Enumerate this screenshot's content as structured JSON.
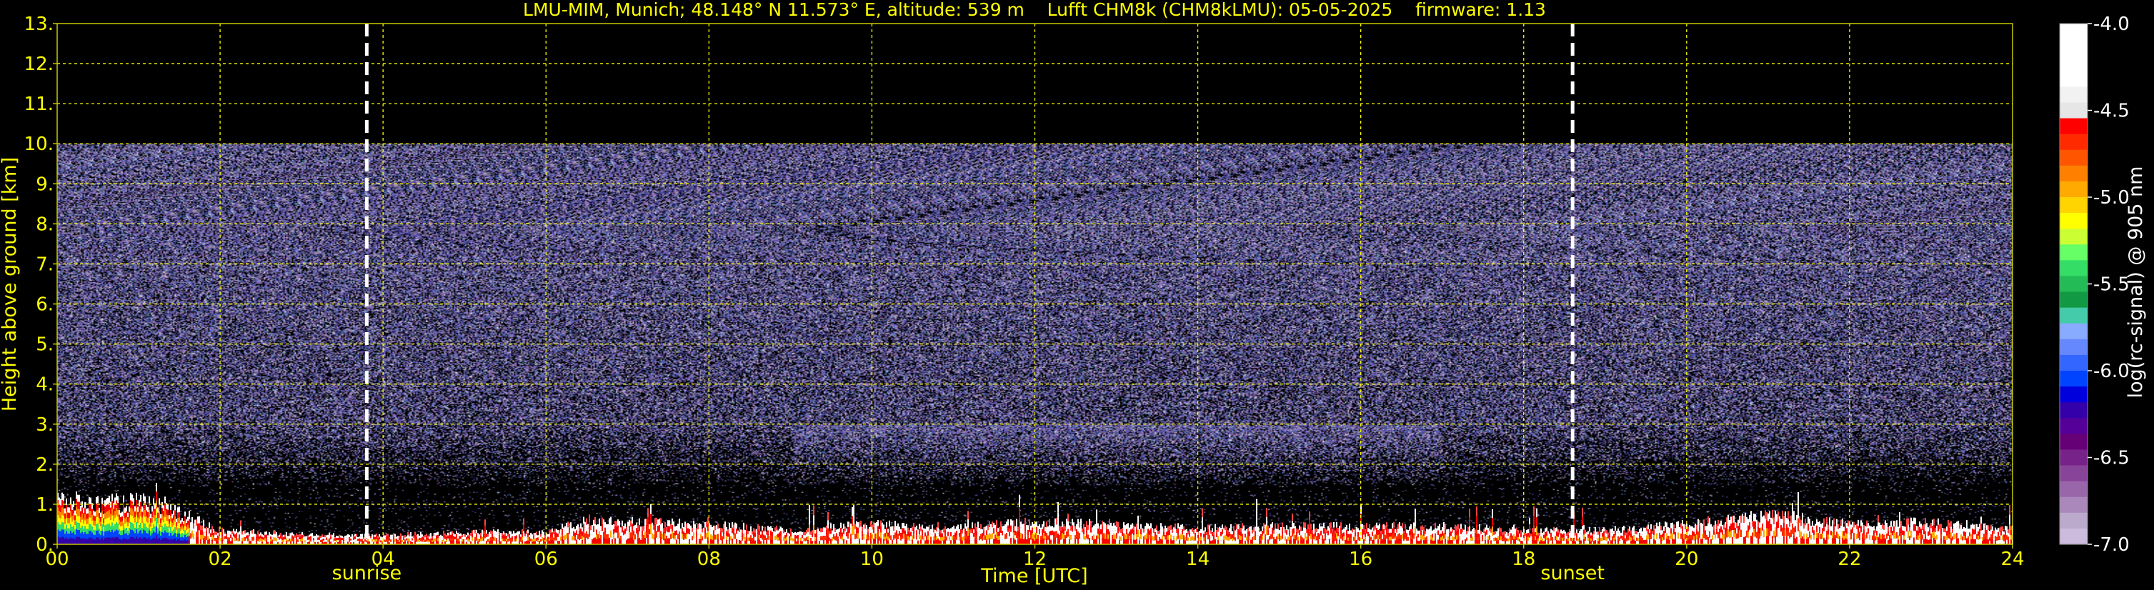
{
  "colors": {
    "background": "#000000",
    "text": "#ffff00",
    "grid": "#ffff00",
    "frame": "#c8c800",
    "marker": "#ffffff",
    "colorbar_text": "#ffffff"
  },
  "chart_data": {
    "type": "heatmap",
    "title": "LMU-MIM, Munich; 48.148° N 11.573° E, altitude: 539 m    Lufft CHM8k (CHM8kLMU): 05-05-2025    firmware: 1.13",
    "xlabel": "Time [UTC]",
    "ylabel": "Height above ground [km]",
    "xlim": [
      0,
      24
    ],
    "ylim": [
      0,
      13
    ],
    "x_ticks": [
      0,
      2,
      4,
      6,
      8,
      10,
      12,
      14,
      16,
      18,
      20,
      22,
      24
    ],
    "x_tick_labels": [
      "00",
      "02",
      "04",
      "06",
      "08",
      "10",
      "12",
      "14",
      "16",
      "18",
      "20",
      "22",
      "24"
    ],
    "y_ticks": [
      0,
      1,
      2,
      3,
      4,
      5,
      6,
      7,
      8,
      9,
      10,
      11,
      12,
      13
    ],
    "y_tick_labels": [
      "0.",
      "1.",
      "2.",
      "3.",
      "4.",
      "5.",
      "6.",
      "7.",
      "8.",
      "9.",
      "10.",
      "11.",
      "12.",
      "13."
    ],
    "grid": true,
    "measurement_top_km": 10.0,
    "events": [
      {
        "label": "sunrise",
        "x": 3.8
      },
      {
        "label": "sunset",
        "x": 18.6
      }
    ],
    "colorbar": {
      "label": "log(rc-signal) @ 905 nm",
      "range": [
        -7.0,
        -4.0
      ],
      "ticks": [
        -4.0,
        -4.5,
        -5.0,
        -5.5,
        -6.0,
        -6.5,
        -7.0
      ],
      "tick_labels": [
        "-4.0",
        "-4.5",
        "-5.0",
        "-5.5",
        "-6.0",
        "-6.5",
        "-7.0"
      ],
      "colors_top_to_bottom": [
        "#ffffff",
        "#ffffff",
        "#ffffff",
        "#ffffff",
        "#f2f2f2",
        "#e6e6e6",
        "#ff0000",
        "#ff2a00",
        "#ff5500",
        "#ff8000",
        "#ffaa00",
        "#ffd400",
        "#ffff00",
        "#ccff33",
        "#66ff66",
        "#33dd66",
        "#22bb55",
        "#119944",
        "#44ccaa",
        "#88aaff",
        "#6688ff",
        "#3366ff",
        "#0044ff",
        "#0000dd",
        "#3300aa",
        "#550099",
        "#660077",
        "#772288",
        "#884499",
        "#9966aa",
        "#aa88bb",
        "#bbaacc",
        "#ccbbdd"
      ]
    },
    "cloud_layer_profile": {
      "note": "approximate height (km) of the dense near-surface signal",
      "x": [
        0,
        0.5,
        1,
        1.5,
        2,
        3,
        4,
        5,
        6,
        6.5,
        7,
        8,
        9,
        10,
        11,
        12,
        13,
        14,
        15,
        16,
        17,
        18,
        19,
        20,
        21,
        22,
        23,
        24
      ],
      "y": [
        1.1,
        1.0,
        1.05,
        0.8,
        0.35,
        0.25,
        0.22,
        0.3,
        0.3,
        0.6,
        0.55,
        0.5,
        0.35,
        0.5,
        0.45,
        0.55,
        0.5,
        0.4,
        0.45,
        0.45,
        0.45,
        0.35,
        0.35,
        0.5,
        0.75,
        0.5,
        0.55,
        0.4
      ]
    }
  }
}
